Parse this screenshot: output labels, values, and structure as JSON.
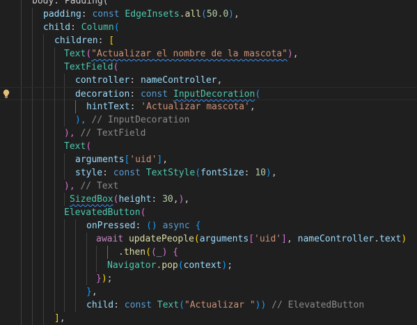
{
  "editor": {
    "lines": [
      {
        "tokens": [
          [
            "t-pun",
            "body: Padding("
          ]
        ]
      },
      {
        "tokens": [
          [
            "t-id",
            "padding"
          ],
          [
            "t-pun",
            ": "
          ],
          [
            "t-kw",
            "const "
          ],
          [
            "t-cls",
            "EdgeInsets"
          ],
          [
            "t-pun",
            "."
          ],
          [
            "t-fn",
            "all"
          ],
          [
            "t-b3",
            "("
          ],
          [
            "t-num",
            "50.0"
          ],
          [
            "t-b3",
            ")"
          ],
          [
            "t-pun",
            ","
          ]
        ]
      },
      {
        "tokens": [
          [
            "t-id",
            "child"
          ],
          [
            "t-pun",
            ": "
          ],
          [
            "t-cls",
            "Column"
          ],
          [
            "t-b3",
            "("
          ]
        ]
      },
      {
        "tokens": [
          [
            "t-id",
            "children"
          ],
          [
            "t-pun",
            ": "
          ],
          [
            "t-b1",
            "["
          ]
        ]
      },
      {
        "tokens": [
          [
            "t-cls",
            "Text"
          ],
          [
            "t-b2",
            "("
          ],
          [
            "t-str squig",
            "\"Actualizar el nombre de la mascota\""
          ],
          [
            "t-b2",
            ")"
          ],
          [
            "t-pun",
            ","
          ]
        ]
      },
      {
        "tokens": [
          [
            "t-cls",
            "TextField"
          ],
          [
            "t-b2",
            "("
          ]
        ]
      },
      {
        "tokens": [
          [
            "t-id",
            "controller"
          ],
          [
            "t-pun",
            ": "
          ],
          [
            "t-id",
            "nameController"
          ],
          [
            "t-pun",
            ","
          ]
        ]
      },
      {
        "tokens": [
          [
            "t-id",
            "decoration"
          ],
          [
            "t-pun",
            ": "
          ],
          [
            "t-kw",
            "const "
          ],
          [
            "t-cls squig",
            "InputDecoration"
          ],
          [
            "t-b3",
            "("
          ]
        ]
      },
      {
        "tokens": [
          [
            "t-id",
            "hintText"
          ],
          [
            "t-pun",
            ": "
          ],
          [
            "t-str",
            "'Actualizar mascota'"
          ],
          [
            "t-pun",
            ","
          ]
        ]
      },
      {
        "tokens": [
          [
            "t-b3",
            "), "
          ],
          [
            "t-hint",
            "// InputDecoration"
          ]
        ]
      },
      {
        "tokens": [
          [
            "t-b2",
            "), "
          ],
          [
            "t-hint",
            "// TextField"
          ]
        ]
      },
      {
        "tokens": [
          [
            "t-cls",
            "Text"
          ],
          [
            "t-b2",
            "("
          ]
        ]
      },
      {
        "tokens": [
          [
            "t-id",
            "arguments"
          ],
          [
            "t-b3",
            "["
          ],
          [
            "t-str",
            "'uid'"
          ],
          [
            "t-b3",
            "]"
          ],
          [
            "t-pun",
            ","
          ]
        ]
      },
      {
        "tokens": [
          [
            "t-id",
            "style"
          ],
          [
            "t-pun",
            ": "
          ],
          [
            "t-kw",
            "const "
          ],
          [
            "t-cls",
            "TextStyle"
          ],
          [
            "t-b3",
            "("
          ],
          [
            "t-id",
            "fontSize"
          ],
          [
            "t-pun",
            ": "
          ],
          [
            "t-num",
            "10"
          ],
          [
            "t-b3",
            ")"
          ],
          [
            "t-pun",
            ","
          ]
        ]
      },
      {
        "tokens": [
          [
            "t-b2",
            "), "
          ],
          [
            "t-hint",
            "// Text"
          ]
        ]
      },
      {
        "tokens": [
          [
            "t-cls squig",
            "SizedBox"
          ],
          [
            "t-b2",
            "("
          ],
          [
            "t-id",
            "height"
          ],
          [
            "t-pun",
            ": "
          ],
          [
            "t-num",
            "30"
          ],
          [
            "t-pun",
            ","
          ],
          [
            "t-b2",
            ")"
          ],
          [
            "t-pun",
            ","
          ]
        ]
      },
      {
        "tokens": [
          [
            "t-cls",
            "ElevatedButton"
          ],
          [
            "t-b2",
            "("
          ]
        ]
      },
      {
        "tokens": [
          [
            "t-id",
            "onPressed"
          ],
          [
            "t-pun",
            ": "
          ],
          [
            "t-b3",
            "() "
          ],
          [
            "t-kw",
            "async "
          ],
          [
            "t-b3",
            "{"
          ]
        ]
      },
      {
        "tokens": [
          [
            "t-kw2",
            "await "
          ],
          [
            "t-fn",
            "updatePeople"
          ],
          [
            "t-b1",
            "("
          ],
          [
            "t-id",
            "arguments"
          ],
          [
            "t-b2",
            "["
          ],
          [
            "t-str",
            "'uid'"
          ],
          [
            "t-b2",
            "]"
          ],
          [
            "t-pun",
            ", "
          ],
          [
            "t-id",
            "nameController"
          ],
          [
            "t-pun",
            "."
          ],
          [
            "t-id",
            "text"
          ],
          [
            "t-b1",
            ")"
          ]
        ]
      },
      {
        "tokens": [
          [
            "t-pun",
            "."
          ],
          [
            "t-fn",
            "then"
          ],
          [
            "t-b1",
            "("
          ],
          [
            "t-b2",
            "("
          ],
          [
            "t-id",
            "_"
          ],
          [
            "t-b2",
            ") "
          ],
          [
            "t-b2",
            "{"
          ]
        ]
      },
      {
        "tokens": [
          [
            "t-cls",
            "Navigator"
          ],
          [
            "t-pun",
            "."
          ],
          [
            "t-fn",
            "pop"
          ],
          [
            "t-b3",
            "("
          ],
          [
            "t-id",
            "context"
          ],
          [
            "t-b3",
            ")"
          ],
          [
            "t-pun",
            ";"
          ]
        ]
      },
      {
        "tokens": [
          [
            "t-b2",
            "}"
          ],
          [
            "t-b1",
            ")"
          ],
          [
            "t-pun",
            ";"
          ]
        ]
      },
      {
        "tokens": [
          [
            "t-b3",
            "}"
          ],
          [
            "t-pun",
            ","
          ]
        ]
      },
      {
        "tokens": [
          [
            "t-id",
            "child"
          ],
          [
            "t-pun",
            ": "
          ],
          [
            "t-kw",
            "const "
          ],
          [
            "t-cls",
            "Text"
          ],
          [
            "t-b3",
            "("
          ],
          [
            "t-str",
            "\"Actualizar \""
          ],
          [
            "t-b3",
            "))"
          ],
          [
            "t-pun",
            " "
          ],
          [
            "t-hint",
            "// ElevatedButton"
          ]
        ]
      },
      {
        "tokens": [
          [
            "t-b1",
            "]"
          ],
          [
            "t-pun",
            ","
          ]
        ]
      }
    ],
    "lightbulb_icon": "lightbulb-icon"
  }
}
